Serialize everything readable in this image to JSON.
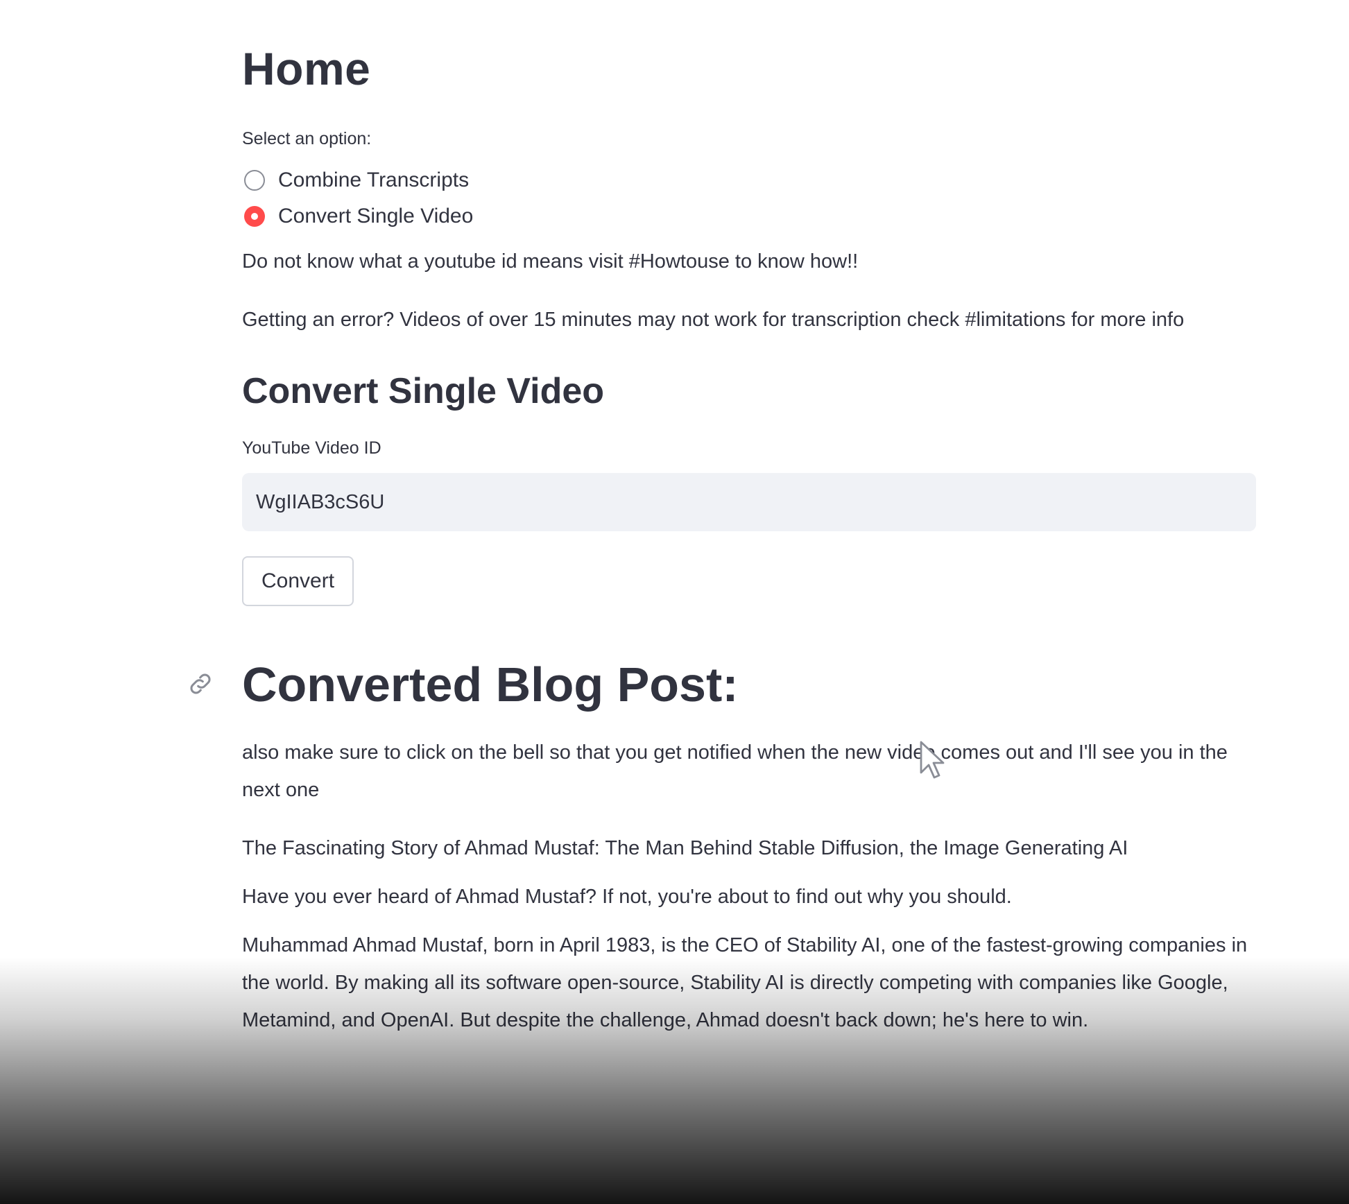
{
  "page": {
    "title": "Home"
  },
  "options": {
    "label": "Select an option:",
    "items": [
      {
        "label": "Combine Transcripts",
        "selected": false
      },
      {
        "label": "Convert Single Video",
        "selected": true
      }
    ],
    "accent_color": "#ff4b4b"
  },
  "info": {
    "help_text": "Do not know what a youtube id means visit #Howtouse to know how!!",
    "error_text": "Getting an error? Videos of over 15 minutes may not work for transcription check #limitations for more info"
  },
  "converter": {
    "section_title": "Convert Single Video",
    "input_label": "YouTube Video ID",
    "input_value": "WgIIAB3cS6U",
    "button_label": "Convert"
  },
  "blog": {
    "heading": "Converted Blog Post:",
    "link_icon": "link-icon",
    "paragraphs": [
      "also make sure to click on the bell so that you get notified when the new video comes out and I'll see you in the next one",
      "The Fascinating Story of Ahmad Mustaf: The Man Behind Stable Diffusion, the Image Generating AI",
      "Have you ever heard of Ahmad Mustaf? If not, you're about to find out why you should.",
      "Muhammad Ahmad Mustaf, born in April 1983, is the CEO of Stability AI, one of the fastest-growing companies in the world. By making all its software open-source, Stability AI is directly competing with companies like Google, Metamind, and OpenAI. But despite the challenge, Ahmad doesn't back down; he's here to win."
    ]
  }
}
